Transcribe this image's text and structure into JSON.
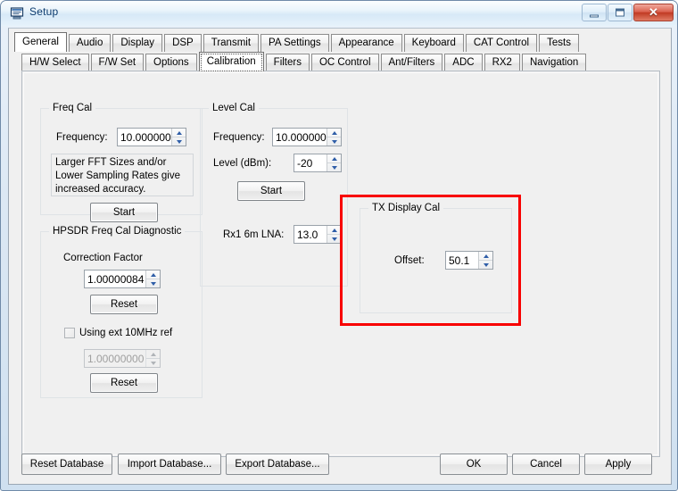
{
  "window": {
    "title": "Setup",
    "icon": "app-window-icon",
    "controls": {
      "minimize": "minimize-icon",
      "maximize": "maximize-icon",
      "close": "✕"
    }
  },
  "tabs_primary": [
    {
      "label": "General",
      "selected": true
    },
    {
      "label": "Audio",
      "selected": false
    },
    {
      "label": "Display",
      "selected": false
    },
    {
      "label": "DSP",
      "selected": false
    },
    {
      "label": "Transmit",
      "selected": false
    },
    {
      "label": "PA Settings",
      "selected": false
    },
    {
      "label": "Appearance",
      "selected": false
    },
    {
      "label": "Keyboard",
      "selected": false
    },
    {
      "label": "CAT Control",
      "selected": false
    },
    {
      "label": "Tests",
      "selected": false
    }
  ],
  "tabs_secondary": [
    {
      "label": "H/W Select",
      "selected": false
    },
    {
      "label": "F/W Set",
      "selected": false
    },
    {
      "label": "Options",
      "selected": false
    },
    {
      "label": "Calibration",
      "selected": true
    },
    {
      "label": "Filters",
      "selected": false
    },
    {
      "label": "OC Control",
      "selected": false
    },
    {
      "label": "Ant/Filters",
      "selected": false
    },
    {
      "label": "ADC",
      "selected": false
    },
    {
      "label": "RX2",
      "selected": false
    },
    {
      "label": "Navigation",
      "selected": false
    }
  ],
  "freq_cal": {
    "legend": "Freq Cal",
    "frequency_label": "Frequency:",
    "frequency_value": "10.000000",
    "note": "Larger FFT Sizes and/or Lower Sampling Rates give increased accuracy.",
    "start_button": "Start"
  },
  "hpsdr_diag": {
    "legend": "HPSDR Freq Cal Diagnostic",
    "correction_factor_label": "Correction Factor",
    "correction_factor_value": "1.00000084",
    "reset_button_1": "Reset",
    "ext_ref_checkbox_label": "Using ext 10MHz ref",
    "ext_ref_checked": false,
    "ext_ref_value": "1.00000000",
    "reset_button_2": "Reset"
  },
  "level_cal": {
    "legend": "Level Cal",
    "frequency_label": "Frequency:",
    "frequency_value": "10.000000",
    "level_label": "Level (dBm):",
    "level_value": "-20",
    "start_button": "Start",
    "lna_label": "Rx1 6m LNA:",
    "lna_value": "13.0"
  },
  "tx_display_cal": {
    "legend": "TX Display Cal",
    "offset_label": "Offset:",
    "offset_value": "50.1"
  },
  "annotation": {
    "color": "#f80000",
    "kind": "highlight-rectangle"
  },
  "footer": {
    "reset_database": "Reset Database",
    "import_database": "Import Database...",
    "export_database": "Export Database...",
    "ok": "OK",
    "cancel": "Cancel",
    "apply": "Apply"
  }
}
